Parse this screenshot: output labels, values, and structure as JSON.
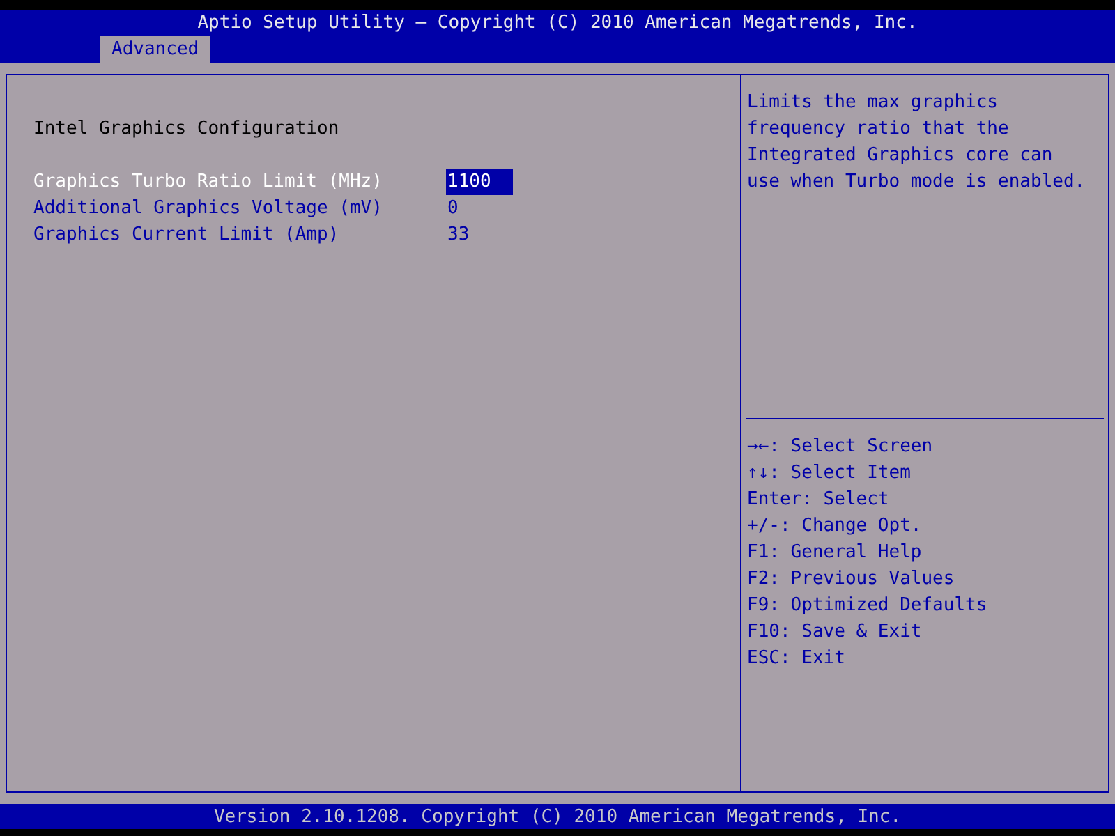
{
  "header": {
    "title": "Aptio Setup Utility – Copyright (C) 2010 American Megatrends, Inc.",
    "tabs": [
      {
        "label": "Advanced",
        "selected": true
      }
    ]
  },
  "main": {
    "heading": "Intel Graphics Configuration",
    "settings": [
      {
        "label": "Graphics Turbo Ratio Limit (MHz)",
        "value": "1100",
        "selected": true
      },
      {
        "label": "Additional Graphics Voltage (mV)",
        "value": "0",
        "selected": false
      },
      {
        "label": "Graphics Current Limit (Amp)",
        "value": "33",
        "selected": false
      }
    ]
  },
  "help": {
    "description": [
      "Limits the max graphics",
      "frequency ratio that the",
      "Integrated Graphics core can",
      "use when Turbo mode is enabled."
    ],
    "keys": [
      {
        "key": "→←:",
        "action": "Select Screen"
      },
      {
        "key": "↑↓:",
        "action": "Select Item"
      },
      {
        "key": "Enter:",
        "action": "Select"
      },
      {
        "key": "+/-:",
        "action": "Change Opt."
      },
      {
        "key": "F1:",
        "action": "General Help"
      },
      {
        "key": "F2:",
        "action": "Previous Values"
      },
      {
        "key": "F9:",
        "action": "Optimized Defaults"
      },
      {
        "key": "F10:",
        "action": "Save & Exit"
      },
      {
        "key": "ESC:",
        "action": "Exit"
      }
    ]
  },
  "footer": {
    "text": "Version 2.10.1208. Copyright (C) 2010 American Megatrends, Inc."
  }
}
